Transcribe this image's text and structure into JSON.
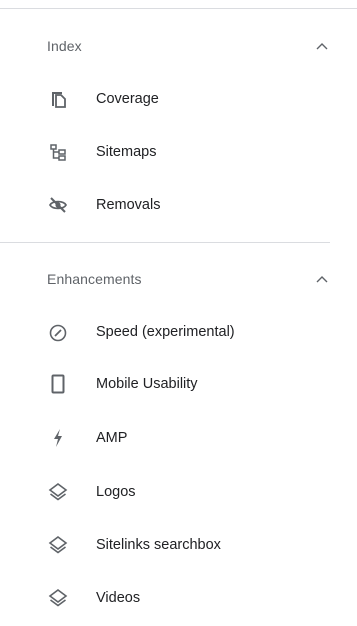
{
  "sections": [
    {
      "title": "Index",
      "expanded": true,
      "items": [
        {
          "label": "Coverage",
          "icon": "coverage-icon"
        },
        {
          "label": "Sitemaps",
          "icon": "sitemap-icon"
        },
        {
          "label": "Removals",
          "icon": "visibility-off-icon"
        }
      ]
    },
    {
      "title": "Enhancements",
      "expanded": true,
      "items": [
        {
          "label": "Speed (experimental)",
          "icon": "speed-gauge-icon"
        },
        {
          "label": "Mobile Usability",
          "icon": "mobile-phone-icon"
        },
        {
          "label": "AMP",
          "icon": "amp-bolt-icon"
        },
        {
          "label": "Logos",
          "icon": "layers-icon"
        },
        {
          "label": "Sitelinks searchbox",
          "icon": "layers-icon"
        },
        {
          "label": "Videos",
          "icon": "layers-icon"
        }
      ]
    }
  ],
  "colors": {
    "icon": "#5f6368",
    "text": "#202124",
    "header_text": "#5f6368",
    "divider": "#dadce0"
  }
}
